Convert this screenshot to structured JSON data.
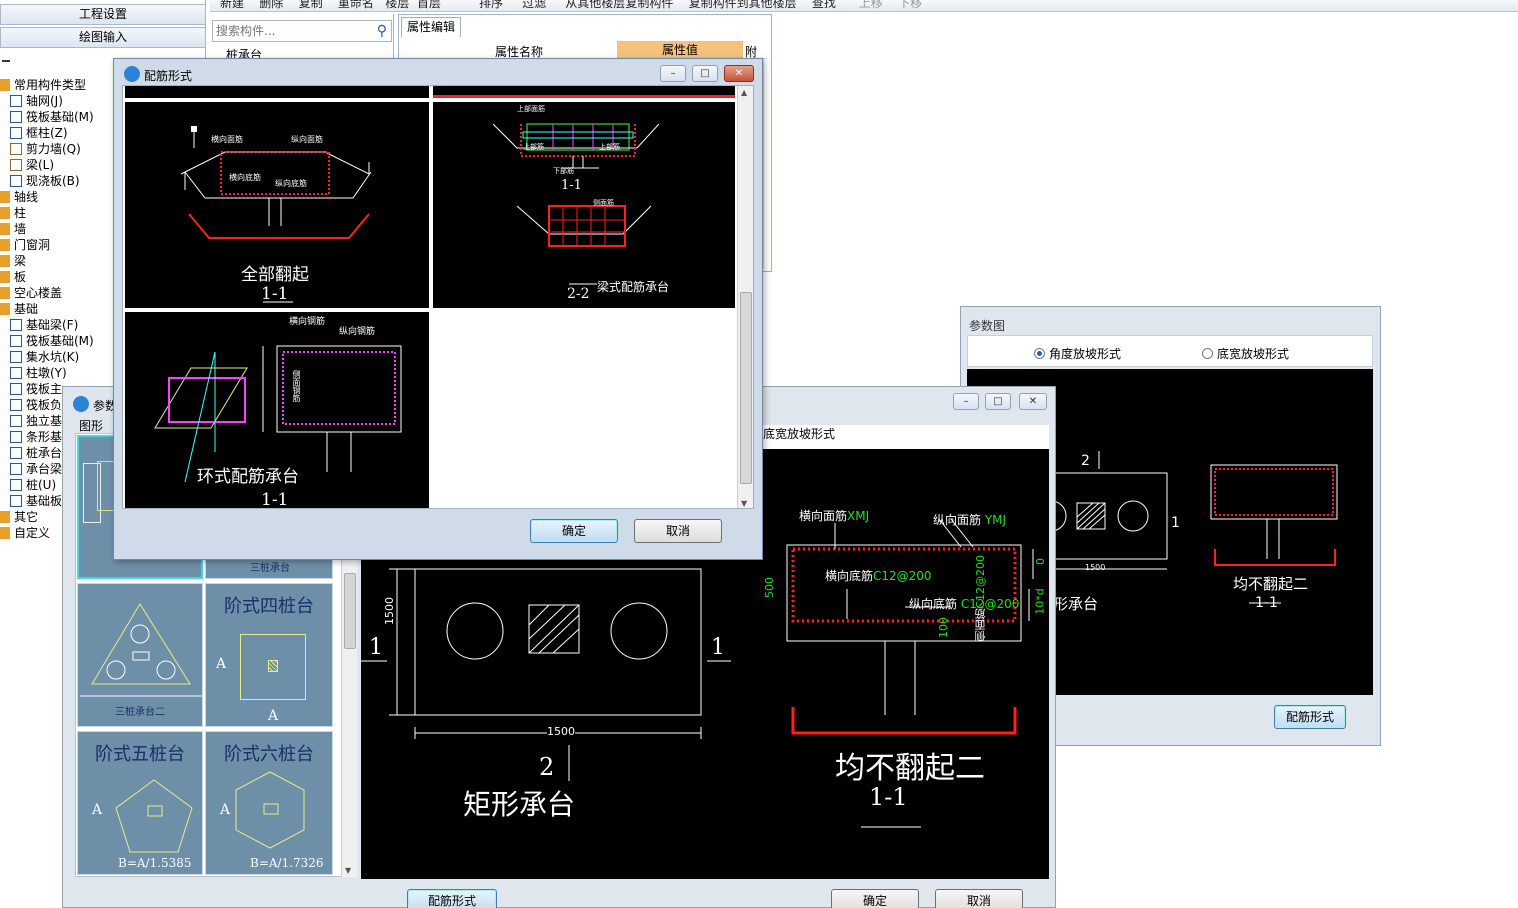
{
  "toolbar": {
    "items": [
      "新建",
      "删除",
      "复制",
      "重命名",
      "楼层",
      "首层",
      "排序",
      "过滤",
      "从其他楼层复制构件",
      "复制构件到其他楼层",
      "查找",
      "上移",
      "下移"
    ]
  },
  "sidebar": {
    "engineering_setup": "工程设置",
    "drawing_input": "绘图输入",
    "items": [
      "常用构件类型",
      "轴网(J)",
      "筏板基础(M)",
      "框柱(Z)",
      "剪力墙(Q)",
      "梁(L)",
      "现浇板(B)",
      "轴线",
      "柱",
      "墙",
      "门窗洞",
      "梁",
      "板",
      "空心楼盖",
      "基础",
      "基础梁(F)",
      "筏板基础(M)",
      "集水坑(K)",
      "柱墩(Y)",
      "筏板主",
      "筏板负",
      "独立基",
      "条形基",
      "桩承台",
      "承台梁",
      "桩(U)",
      "基础板",
      "其它",
      "自定义"
    ]
  },
  "search": {
    "placeholder": "搜索构件..."
  },
  "component_list": {
    "first_item": "桩承台"
  },
  "props": {
    "tab": "属性编辑",
    "col_name": "属性名称",
    "col_value": "属性值",
    "col_extra": "附加"
  },
  "rebar_dialog": {
    "title": "配筋形式",
    "ok": "确定",
    "cancel": "取消",
    "cell1": {
      "caption": "全部翻起",
      "section": "1-1",
      "labels": [
        "横向面筋",
        "纵向面筋",
        "横向底筋",
        "纵向底筋"
      ]
    },
    "cell2": {
      "caption": "梁式配筋承台",
      "section_a": "1-1",
      "section_b": "2-2",
      "labels": [
        "上部面筋",
        "上部筋",
        "下部筋",
        "侧面筋"
      ]
    },
    "cell3": {
      "caption": "环式配筋承台",
      "section": "1-1",
      "labels": [
        "横向钢筋",
        "纵向钢筋",
        "侧面钢筋"
      ]
    }
  },
  "param_dialog_main": {
    "title": "参数图",
    "tab_label": "图形",
    "radio_bottom": "底宽放坡形式",
    "thumbs": [
      {
        "title": "三桩承台二",
        "caption": "三桩承台二"
      },
      {
        "title": "阶式四桩台",
        "dim": "A"
      },
      {
        "title": "阶式五桩台",
        "dim": "A",
        "formula": "B=A/1.5385"
      },
      {
        "title": "阶式六桩台",
        "dim": "A",
        "formula": "B=A/1.7326"
      }
    ],
    "thumb_top_caption": "三桩承台",
    "plan": {
      "caption": "矩形承台",
      "section_mark": "1",
      "section_mark2": "2",
      "width": "1500",
      "height": "1500"
    },
    "section": {
      "caption": "均不翻起二",
      "section": "1-1",
      "top_h": "横向面筋",
      "top_h_suffix": "XMJ",
      "top_v": "纵向面筋",
      "top_v_suffix": "YMJ",
      "bot_h": "横向底筋",
      "bot_h_spec": "C12@200",
      "bot_v": "纵向底筋",
      "bot_v_spec": "C12@200",
      "side": "侧面筋",
      "side_spec": "C12@200",
      "dim_500": "500",
      "dim_0": "0",
      "dim_10d": "10*d",
      "dim_100": "100"
    },
    "rebar_button": "配筋形式",
    "ok": "确定",
    "cancel": "取消"
  },
  "param_dialog_right": {
    "title": "参数图",
    "radio_angle": "角度放坡形式",
    "radio_bottom": "底宽放坡形式",
    "caption_left": "形承台",
    "caption_right": "均不翻起二",
    "section": "1-1",
    "dim": "1500",
    "mark": "2",
    "mark_side": "1",
    "rebar_button": "配筋形式"
  },
  "colors": {
    "accent": "#3c7fb1",
    "cad_bg": "#000000",
    "rebar_red": "#ff2020",
    "rebar_magenta": "#ff40ff",
    "dim_green": "#20e020"
  }
}
